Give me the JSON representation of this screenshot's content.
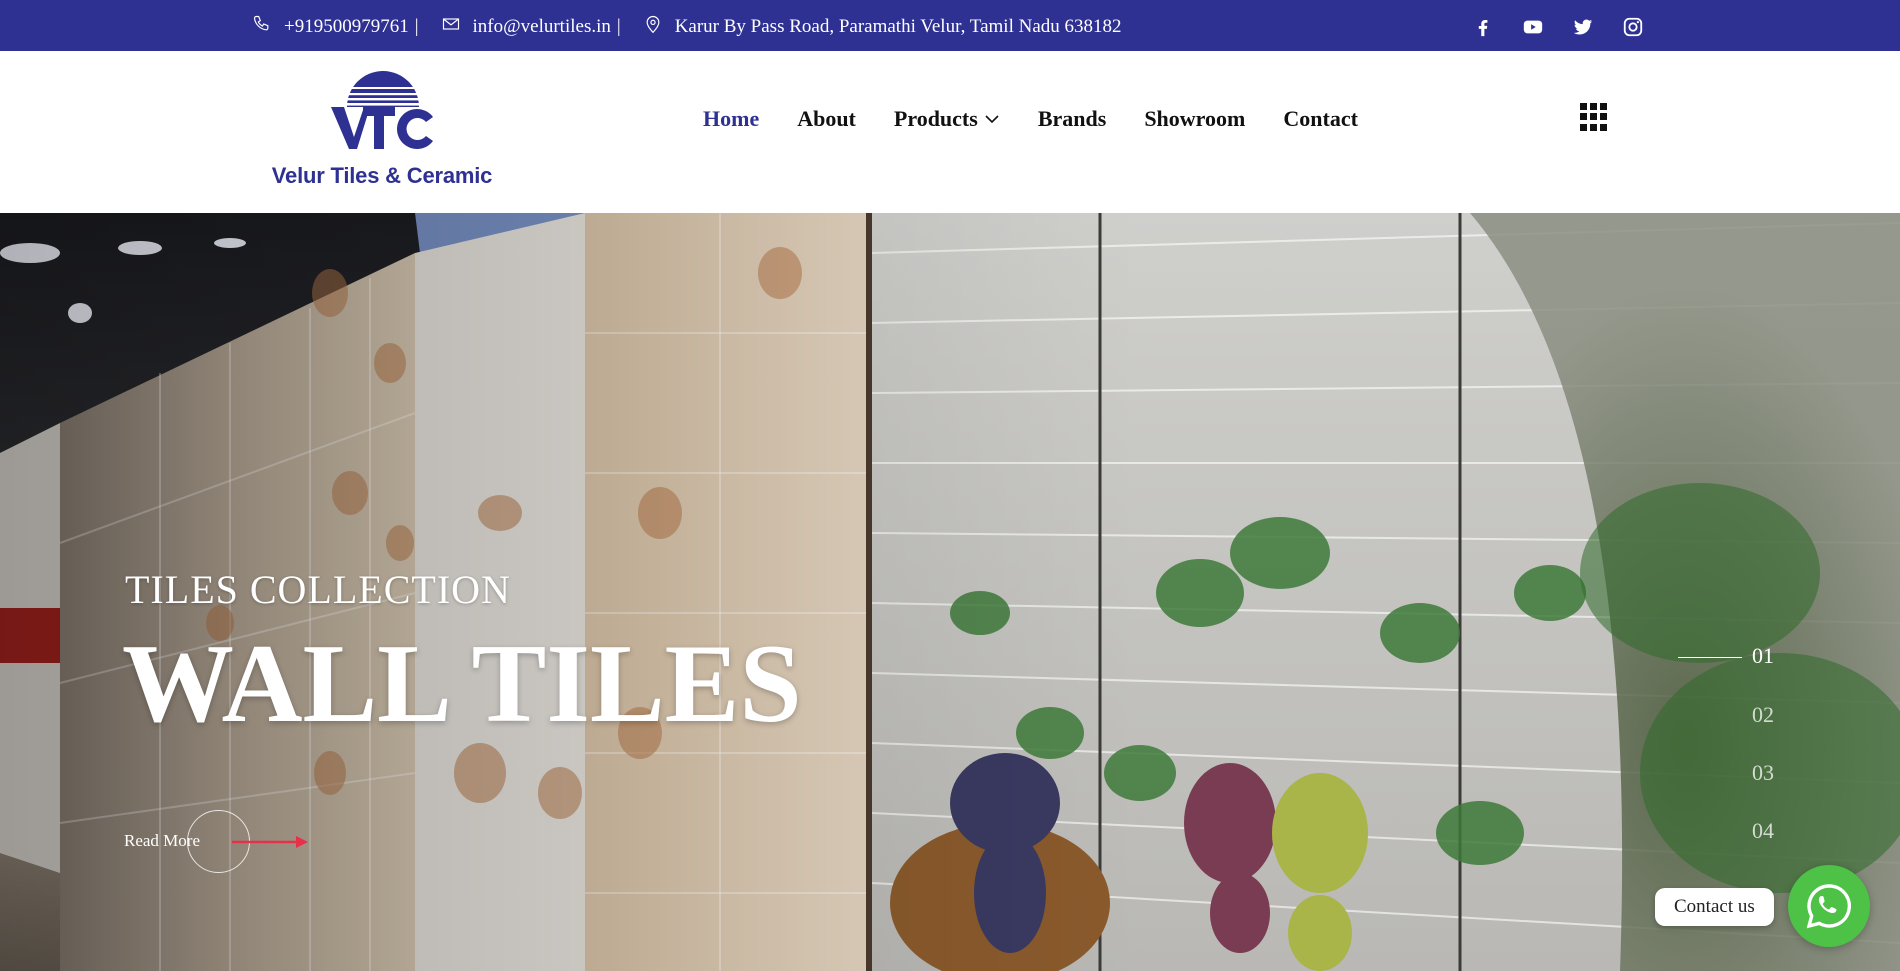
{
  "topbar": {
    "phone": "+919500979761",
    "email": "info@velurtiles.in",
    "address": "Karur By Pass Road, Paramathi Velur, Tamil Nadu 638182",
    "separator": "|",
    "social": [
      "facebook-icon",
      "youtube-icon",
      "twitter-icon",
      "instagram-icon"
    ],
    "background_color": "#2e3192"
  },
  "header": {
    "logo_mark": "VTC",
    "logo_text": "Velur Tiles & Ceramic",
    "nav": {
      "home": "Home",
      "about": "About",
      "products": "Products",
      "brands": "Brands",
      "showroom": "Showroom",
      "contact": "Contact"
    },
    "active_nav": "Home",
    "menu_icon": "grid-menu-icon"
  },
  "hero": {
    "subtitle": "TILES COLLECTION",
    "title": "WALL TILES",
    "cta": "Read More",
    "slides": [
      "01",
      "02",
      "03",
      "04"
    ],
    "active_slide": "01"
  },
  "whatsapp": {
    "label": "Contact us",
    "icon": "whatsapp-icon",
    "color": "#4dc247"
  }
}
